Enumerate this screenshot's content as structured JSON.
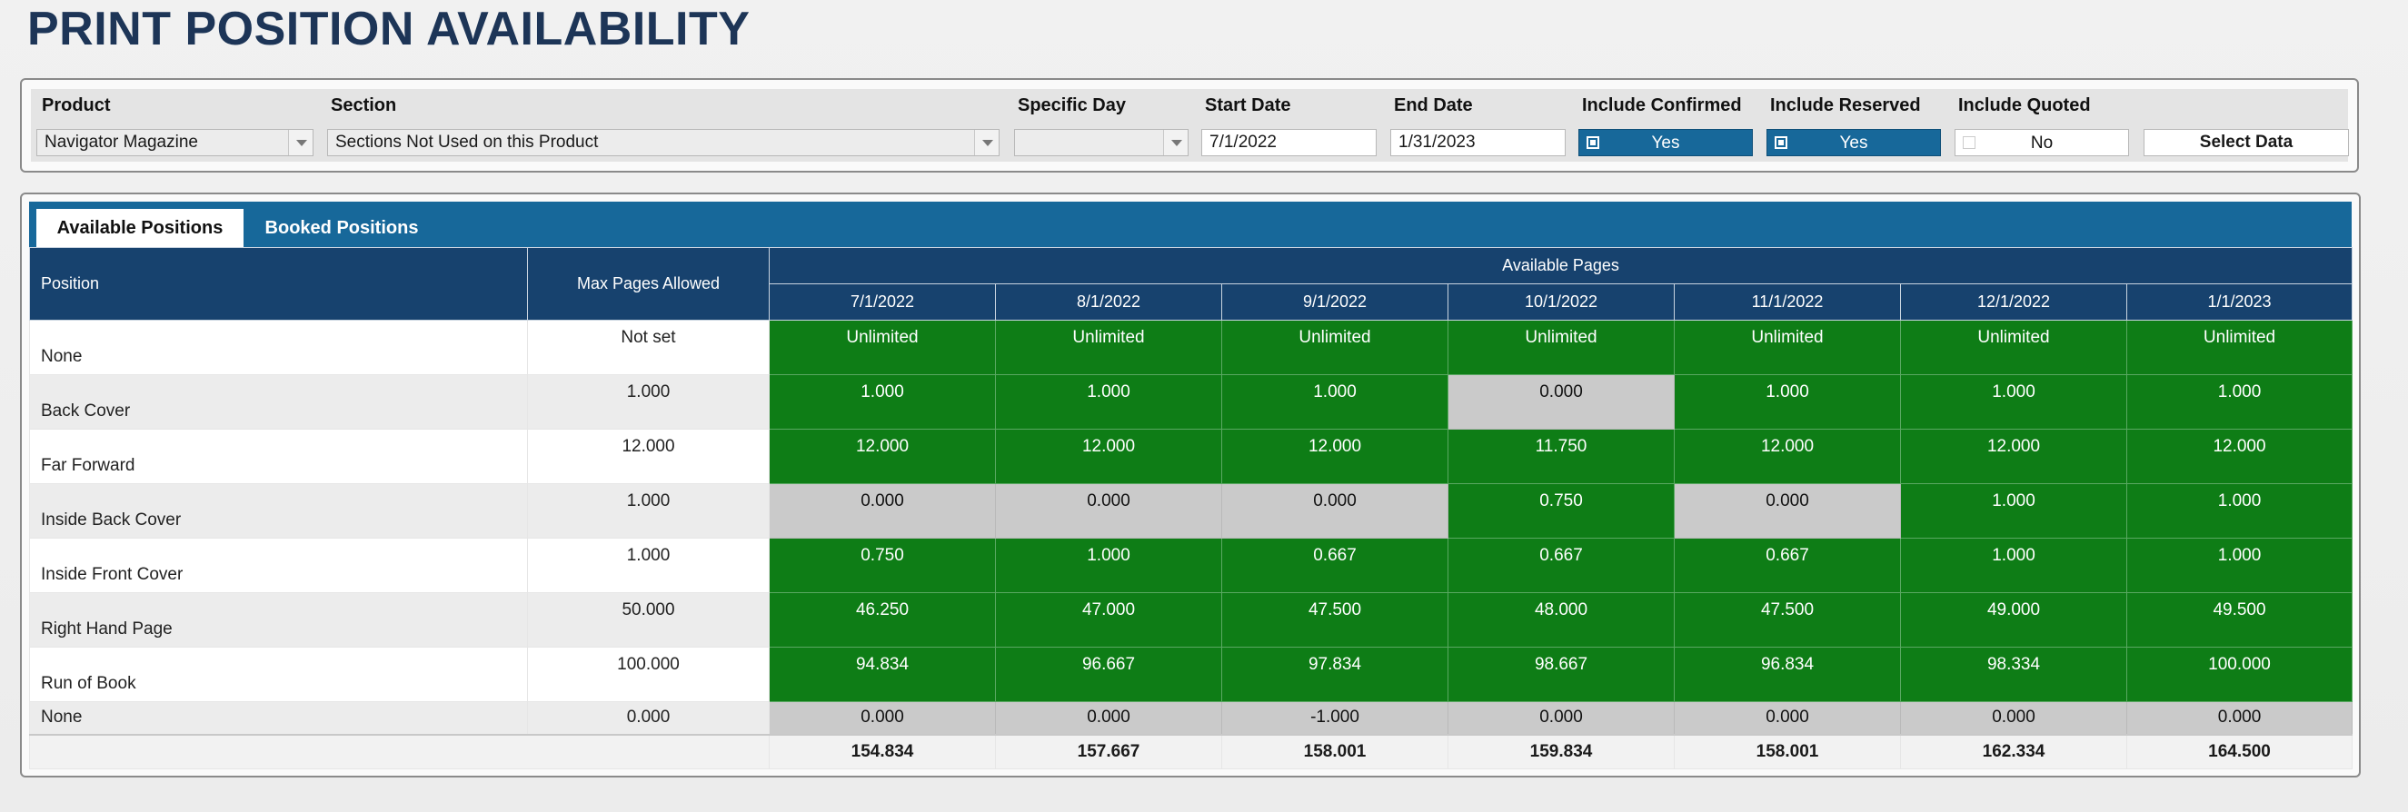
{
  "page": {
    "title": "PRINT POSITION AVAILABILITY"
  },
  "filters": {
    "product": {
      "label": "Product",
      "value": "Navigator Magazine"
    },
    "section": {
      "label": "Section",
      "value": "Sections Not Used on this Product"
    },
    "specific_day": {
      "label": "Specific Day",
      "value": ""
    },
    "start_date": {
      "label": "Start Date",
      "value": "7/1/2022"
    },
    "end_date": {
      "label": "End Date",
      "value": "1/31/2023"
    },
    "include_confirmed": {
      "label": "Include Confirmed",
      "value": "Yes",
      "checked": true
    },
    "include_reserved": {
      "label": "Include Reserved",
      "value": "Yes",
      "checked": true
    },
    "include_quoted": {
      "label": "Include Quoted",
      "value": "No",
      "checked": false
    },
    "select_button": "Select Data"
  },
  "tabs": [
    {
      "label": "Available Positions",
      "active": true
    },
    {
      "label": "Booked Positions",
      "active": false
    }
  ],
  "grid": {
    "header_position": "Position",
    "header_max": "Max Pages Allowed",
    "header_group": "Available Pages",
    "months": [
      "7/1/2022",
      "8/1/2022",
      "9/1/2022",
      "10/1/2022",
      "11/1/2022",
      "12/1/2022",
      "1/1/2023"
    ],
    "rows": [
      {
        "position": "None",
        "max": "Not set",
        "cells": [
          "Unlimited",
          "Unlimited",
          "Unlimited",
          "Unlimited",
          "Unlimited",
          "Unlimited",
          "Unlimited"
        ],
        "status": [
          "g",
          "g",
          "g",
          "g",
          "g",
          "g",
          "g"
        ]
      },
      {
        "position": "Back Cover",
        "max": "1.000",
        "cells": [
          "1.000",
          "1.000",
          "1.000",
          "0.000",
          "1.000",
          "1.000",
          "1.000"
        ],
        "status": [
          "g",
          "g",
          "g",
          "x",
          "g",
          "g",
          "g"
        ]
      },
      {
        "position": "Far Forward",
        "max": "12.000",
        "cells": [
          "12.000",
          "12.000",
          "12.000",
          "11.750",
          "12.000",
          "12.000",
          "12.000"
        ],
        "status": [
          "g",
          "g",
          "g",
          "g",
          "g",
          "g",
          "g"
        ]
      },
      {
        "position": "Inside Back Cover",
        "max": "1.000",
        "cells": [
          "0.000",
          "0.000",
          "0.000",
          "0.750",
          "0.000",
          "1.000",
          "1.000"
        ],
        "status": [
          "x",
          "x",
          "x",
          "g",
          "x",
          "g",
          "g"
        ]
      },
      {
        "position": "Inside Front Cover",
        "max": "1.000",
        "cells": [
          "0.750",
          "1.000",
          "0.667",
          "0.667",
          "0.667",
          "1.000",
          "1.000"
        ],
        "status": [
          "g",
          "g",
          "g",
          "g",
          "g",
          "g",
          "g"
        ]
      },
      {
        "position": "Right Hand Page",
        "max": "50.000",
        "cells": [
          "46.250",
          "47.000",
          "47.500",
          "48.000",
          "47.500",
          "49.000",
          "49.500"
        ],
        "status": [
          "g",
          "g",
          "g",
          "g",
          "g",
          "g",
          "g"
        ]
      },
      {
        "position": "Run of Book",
        "max": "100.000",
        "cells": [
          "94.834",
          "96.667",
          "97.834",
          "98.667",
          "96.834",
          "98.334",
          "100.000"
        ],
        "status": [
          "g",
          "g",
          "g",
          "g",
          "g",
          "g",
          "g"
        ]
      },
      {
        "position": "None",
        "max": "0.000",
        "cells": [
          "0.000",
          "0.000",
          "-1.000",
          "0.000",
          "0.000",
          "0.000",
          "0.000"
        ],
        "status": [
          "x",
          "x",
          "x",
          "x",
          "x",
          "x",
          "x"
        ]
      }
    ],
    "totals": [
      "154.834",
      "157.667",
      "158.001",
      "159.834",
      "158.001",
      "162.334",
      "164.500"
    ]
  },
  "colors": {
    "available": "#0e7d16",
    "unavailable": "#cacaca",
    "header": "#17426e",
    "accent": "#17689a",
    "title": "#1d3557"
  }
}
